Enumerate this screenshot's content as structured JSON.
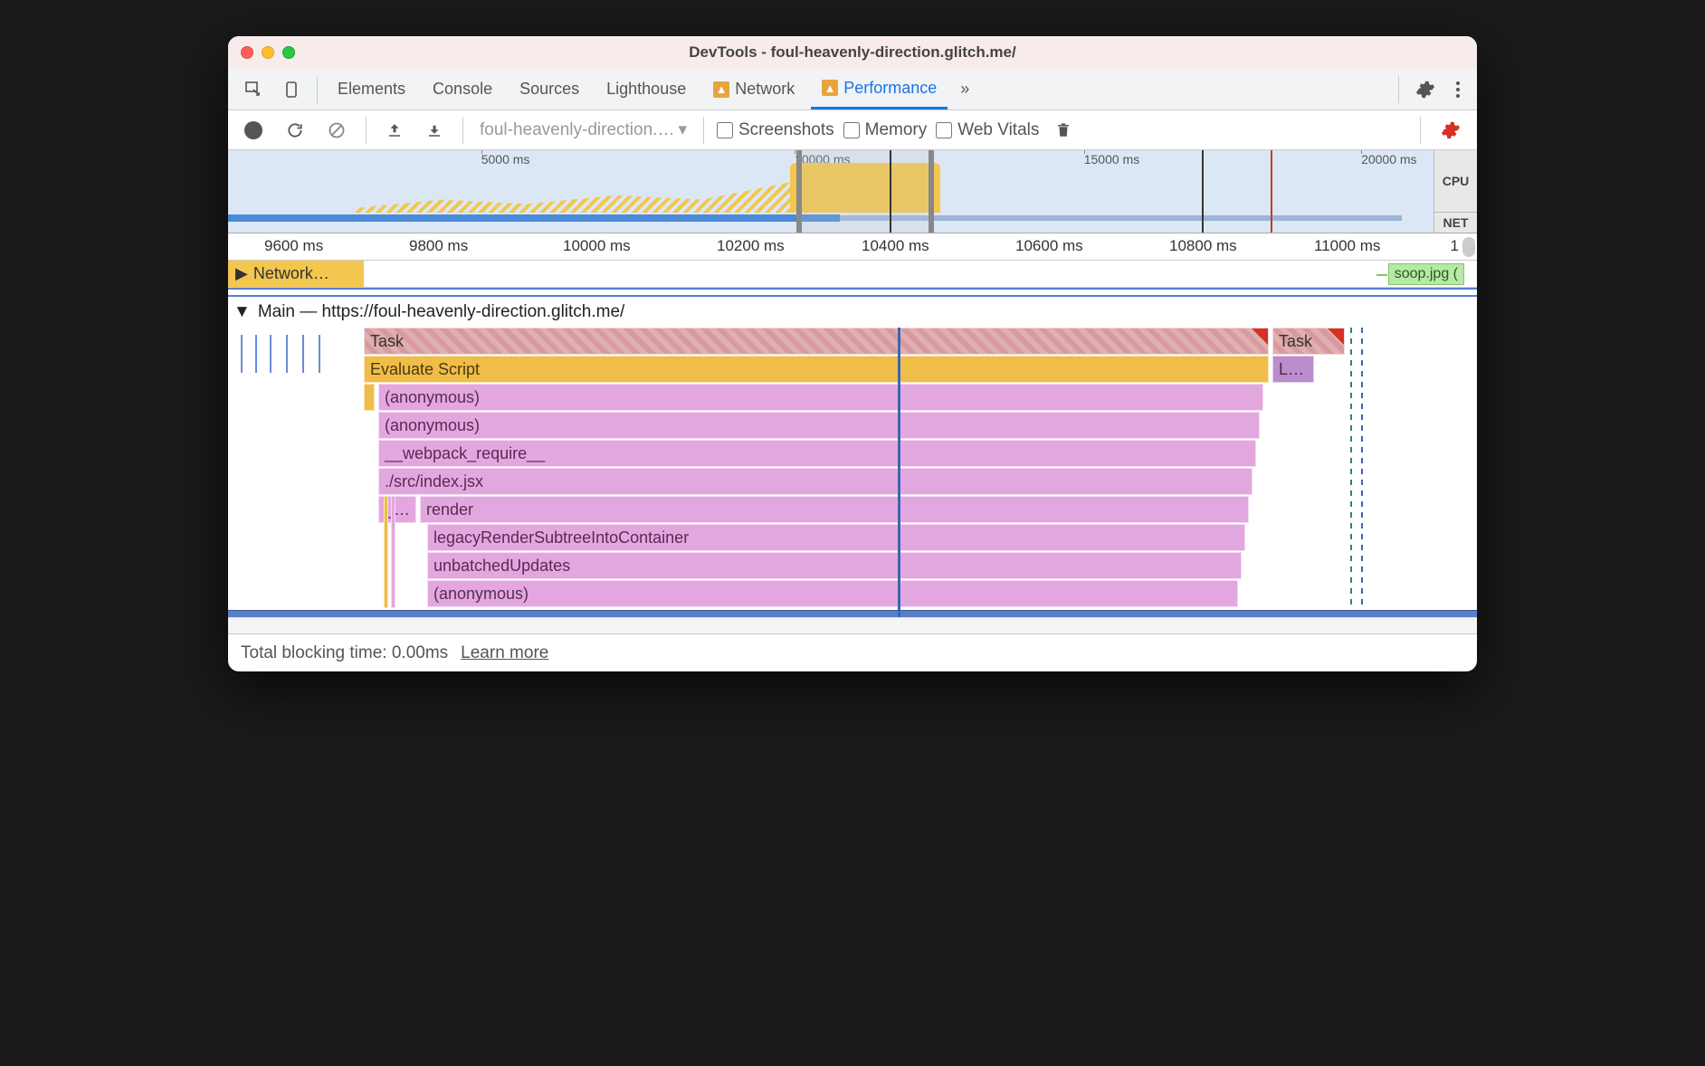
{
  "window": {
    "title": "DevTools - foul-heavenly-direction.glitch.me/"
  },
  "tabs": {
    "elements": "Elements",
    "console": "Console",
    "sources": "Sources",
    "lighthouse": "Lighthouse",
    "network": "Network",
    "performance": "Performance"
  },
  "toolbar": {
    "profile_selector": "foul-heavenly-direction.…",
    "screenshots": "Screenshots",
    "memory": "Memory",
    "web_vitals": "Web Vitals"
  },
  "overview": {
    "ticks": [
      "5000 ms",
      "10000 ms",
      "15000 ms",
      "20000 ms"
    ],
    "cpu_label": "CPU",
    "net_label": "NET"
  },
  "ruler": {
    "ticks": [
      "9600 ms",
      "9800 ms",
      "10000 ms",
      "10200 ms",
      "10400 ms",
      "10600 ms",
      "10800 ms",
      "11000 ms"
    ]
  },
  "network": {
    "label": "Network…",
    "item": "soop.jpg ("
  },
  "main": {
    "header": "Main — https://foul-heavenly-direction.glitch.me/",
    "task": "Task",
    "task2": "Task",
    "layout_short": "L…",
    "eval": "Evaluate Script",
    "anon": "(anonymous)",
    "webpack": "__webpack_require__",
    "srcindex": "./src/index.jsx",
    "short1": "_…",
    "render": "render",
    "legacy": "legacyRenderSubtreeIntoContainer",
    "unbatched": "unbatchedUpdates",
    "anon2": "(anonymous)"
  },
  "footer": {
    "tbt": "Total blocking time: 0.00ms",
    "learn": "Learn more"
  }
}
